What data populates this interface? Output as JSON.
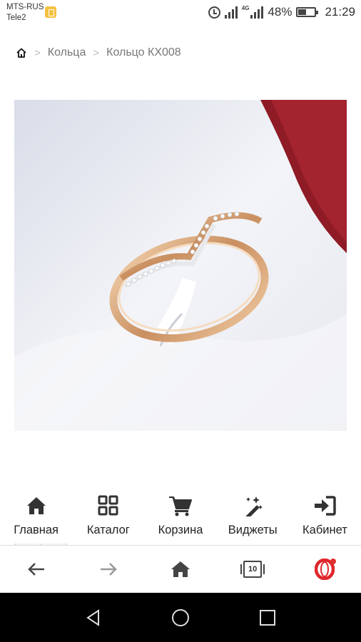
{
  "status_bar": {
    "carrier_1": "MTS-RUS",
    "carrier_2": "Tele2",
    "network": "4G",
    "battery": "48%",
    "time": "21:29"
  },
  "breadcrumb": {
    "items": [
      "Кольца",
      "Кольцо КХ008"
    ]
  },
  "product": {
    "image_icon": "ring-photo"
  },
  "slider": {
    "prev": "‹",
    "next": "›"
  },
  "site_nav": {
    "items": [
      {
        "label": "Главная",
        "icon": "home-icon"
      },
      {
        "label": "Каталог",
        "icon": "catalog-icon"
      },
      {
        "label": "Корзина",
        "icon": "cart-icon"
      },
      {
        "label": "Виджеты",
        "icon": "magic-wand-icon"
      },
      {
        "label": "Кабинет",
        "icon": "login-icon"
      }
    ]
  },
  "browser_bar": {
    "tabs_count": "10",
    "brand_color": "#e0272c"
  },
  "colors": {
    "icon": "#333333",
    "background": "#ffffff"
  }
}
